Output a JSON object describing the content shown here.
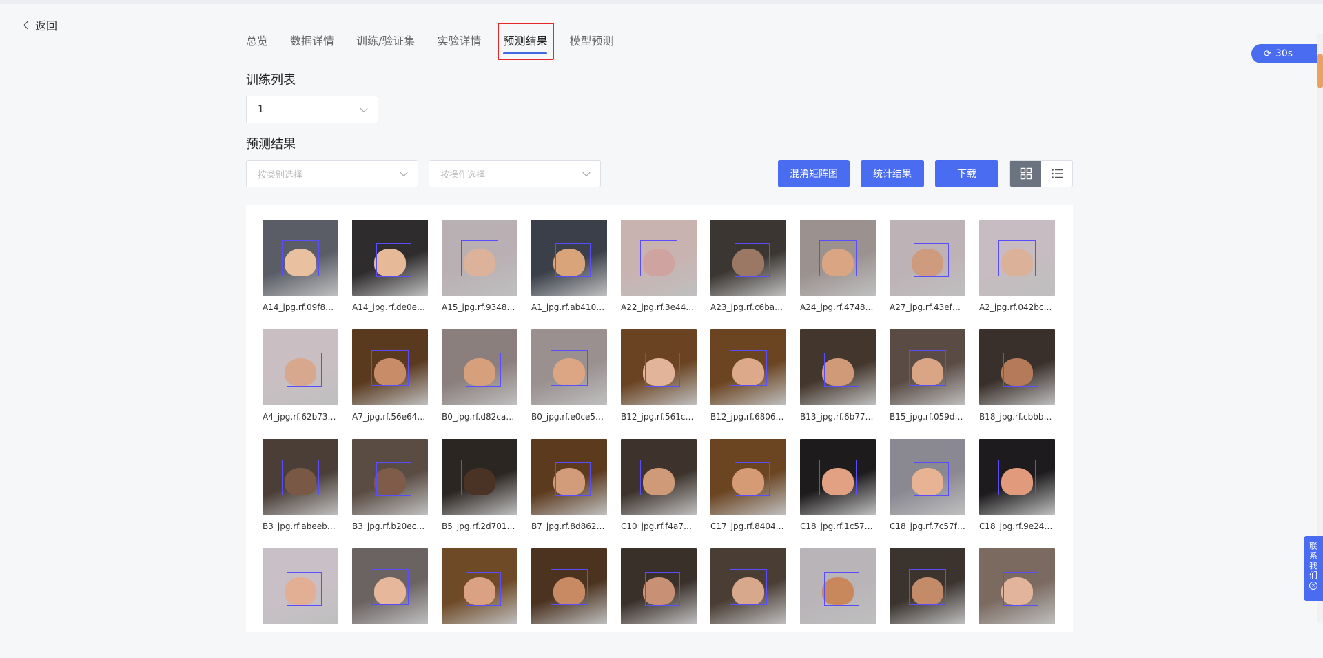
{
  "back_label": "返回",
  "tabs": [
    {
      "label": "总览",
      "active": false
    },
    {
      "label": "数据详情",
      "active": false
    },
    {
      "label": "训练/验证集",
      "active": false
    },
    {
      "label": "实验详情",
      "active": false
    },
    {
      "label": "预测结果",
      "active": true
    },
    {
      "label": "模型预测",
      "active": false
    }
  ],
  "training_list": {
    "title": "训练列表",
    "selected": "1"
  },
  "results": {
    "title": "预测结果",
    "category_placeholder": "按类别选择",
    "operation_placeholder": "按操作选择",
    "confusion_button": "混淆矩阵图",
    "stats_button": "统计结果",
    "download_button": "下载"
  },
  "refresh": {
    "label": "30s"
  },
  "contact": {
    "chars": [
      "联",
      "系",
      "我",
      "们"
    ]
  },
  "colors": {
    "accent": "#4a6cf0",
    "highlight": "#e8262a"
  },
  "images": [
    {
      "caption": "A14_jpg.rf.09f81...",
      "bg": "#5a5d66",
      "skin": "#e9c0a0"
    },
    {
      "caption": "A14_jpg.rf.de0e5...",
      "bg": "#2f2c2e",
      "skin": "#e6b998"
    },
    {
      "caption": "A15_jpg.rf.9348b...",
      "bg": "#b9b0b4",
      "skin": "#dcb39a"
    },
    {
      "caption": "A1_jpg.rf.ab410f1...",
      "bg": "#3a3f49",
      "skin": "#d9a47a"
    },
    {
      "caption": "A22_jpg.rf.3e448...",
      "bg": "#c8b3b1",
      "skin": "#cfa3a0"
    },
    {
      "caption": "A23_jpg.rf.c6ba8...",
      "bg": "#3b3632",
      "skin": "#9b7863"
    },
    {
      "caption": "A24_jpg.rf.47481...",
      "bg": "#9b9290",
      "skin": "#d9a583"
    },
    {
      "caption": "A27_jpg.rf.43ef87...",
      "bg": "#bdb2b5",
      "skin": "#cf9b7f"
    },
    {
      "caption": "A2_jpg.rf.042bce...",
      "bg": "#c6bcc1",
      "skin": "#dcb19a"
    },
    {
      "caption": "A4_jpg.rf.62b735...",
      "bg": "#c9bfc2",
      "skin": "#d7a88e"
    },
    {
      "caption": "A7_jpg.rf.56e641...",
      "bg": "#5a3a1f",
      "skin": "#c98c69"
    },
    {
      "caption": "B0_jpg.rf.d82ca5f...",
      "bg": "#8a7f7d",
      "skin": "#d7a07c"
    },
    {
      "caption": "B0_jpg.rf.e0ce5d...",
      "bg": "#9a9090",
      "skin": "#dca684"
    },
    {
      "caption": "B12_jpg.rf.561cc0...",
      "bg": "#6a4322",
      "skin": "#e2b49a"
    },
    {
      "caption": "B12_jpg.rf.68069...",
      "bg": "#6b4421",
      "skin": "#dcaa8a"
    },
    {
      "caption": "B13_jpg.rf.6b775...",
      "bg": "#43362c",
      "skin": "#d09a78"
    },
    {
      "caption": "B15_jpg.rf.059d0...",
      "bg": "#5a4c45",
      "skin": "#d9a585"
    },
    {
      "caption": "B18_jpg.rf.cbbbe...",
      "bg": "#3a302b",
      "skin": "#b57a5a"
    },
    {
      "caption": "B3_jpg.rf.abeeb4...",
      "bg": "#4a3e36",
      "skin": "#7a5846"
    },
    {
      "caption": "B3_jpg.rf.b20ece...",
      "bg": "#5a4c43",
      "skin": "#7e5c49"
    },
    {
      "caption": "B5_jpg.rf.2d701f0...",
      "bg": "#2c2622",
      "skin": "#4a3325"
    },
    {
      "caption": "B7_jpg.rf.8d8628...",
      "bg": "#5c3a1e",
      "skin": "#d29b79"
    },
    {
      "caption": "C10_jpg.rf.f4a712...",
      "bg": "#3d332c",
      "skin": "#cf9a77"
    },
    {
      "caption": "C17_jpg.rf.8404b...",
      "bg": "#6b4422",
      "skin": "#d49b75"
    },
    {
      "caption": "C18_jpg.rf.1c57c3...",
      "bg": "#1e1b1c",
      "skin": "#e3a184"
    },
    {
      "caption": "C18_jpg.rf.7c57fa...",
      "bg": "#8a8891",
      "skin": "#e8b394"
    },
    {
      "caption": "C18_jpg.rf.9e247f...",
      "bg": "#1d1b1d",
      "skin": "#e19a7b"
    },
    {
      "caption": "",
      "bg": "#c8c0c6",
      "skin": "#e2ae94"
    },
    {
      "caption": "",
      "bg": "#6b6362",
      "skin": "#e6b79a"
    },
    {
      "caption": "",
      "bg": "#6e4a26",
      "skin": "#daa282"
    },
    {
      "caption": "",
      "bg": "#4b3320",
      "skin": "#c78a63"
    },
    {
      "caption": "",
      "bg": "#3a302a",
      "skin": "#c89175"
    },
    {
      "caption": "",
      "bg": "#4a3d34",
      "skin": "#d8a88c"
    },
    {
      "caption": "",
      "bg": "#b9b4b8",
      "skin": "#c9875c"
    },
    {
      "caption": "",
      "bg": "#3a332e",
      "skin": "#c48b69"
    },
    {
      "caption": "",
      "bg": "#7a6a60",
      "skin": "#e2b49b"
    }
  ]
}
